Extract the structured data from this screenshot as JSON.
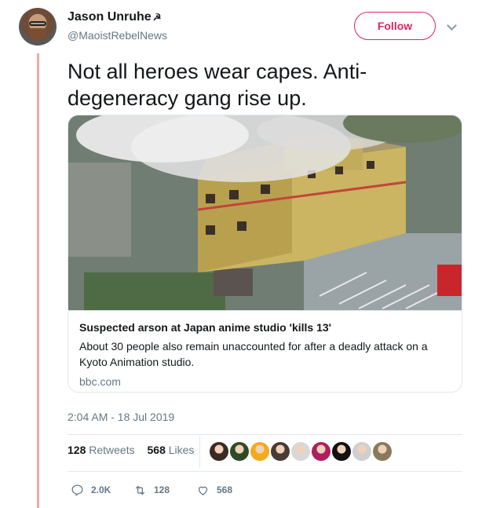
{
  "author": {
    "name": "Jason Unruhe",
    "name_emoji": "☭",
    "handle": "@MaoistRebelNews"
  },
  "follow_label": "Follow",
  "tweet": {
    "line1": "Not all heroes wear capes. Anti-",
    "line2": "degeneracy gang rise up."
  },
  "card": {
    "title": "Suspected arson at Japan anime studio 'kills 13'",
    "description_line1": "About 30 people also remain unaccounted for after a deadly attack on a",
    "description_line2": "Kyoto Animation studio.",
    "domain": "bbc.com"
  },
  "timestamp": "2:04 AM - 18 Jul 2019",
  "stats": {
    "retweets_count": "128",
    "retweets_label": "Retweets",
    "likes_count": "568",
    "likes_label": "Likes"
  },
  "liker_avatars": [
    {
      "icon": "liker-avatar-icon",
      "color": "#3b2a22"
    },
    {
      "icon": "liker-avatar-icon",
      "color": "#2f4a27"
    },
    {
      "icon": "liker-avatar-icon",
      "color": "#f4a91f"
    },
    {
      "icon": "liker-avatar-icon",
      "color": "#4a3b34"
    },
    {
      "icon": "liker-avatar-icon",
      "color": "#d8d8d8"
    },
    {
      "icon": "liker-avatar-icon",
      "color": "#b01e5e"
    },
    {
      "icon": "liker-avatar-icon",
      "color": "#111111"
    },
    {
      "icon": "liker-avatar-icon",
      "color": "#cfcfcf"
    },
    {
      "icon": "liker-avatar-icon",
      "color": "#8a7a5c"
    }
  ],
  "actions": {
    "reply_count": "2.0K",
    "retweet_count": "128",
    "like_count": "568"
  },
  "colors": {
    "accent": "#e0245e",
    "muted": "#657786",
    "thread_line": "#f2a8a8"
  }
}
